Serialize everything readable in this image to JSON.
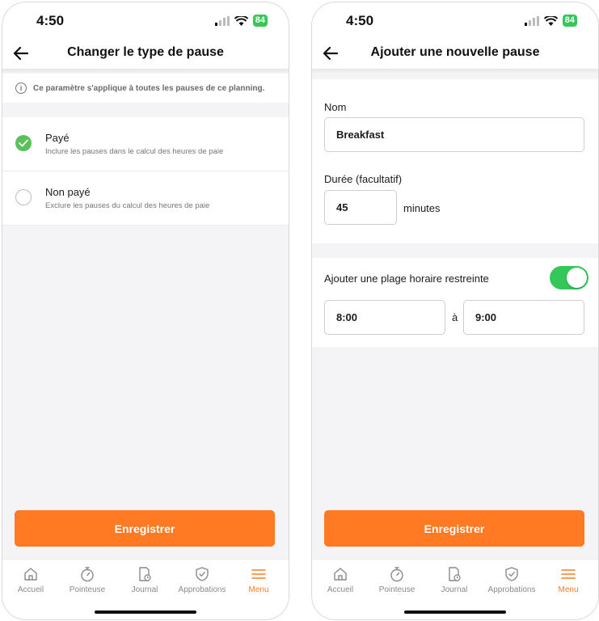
{
  "status": {
    "time": "4:50",
    "battery": "84"
  },
  "left": {
    "title": "Changer le type de pause",
    "info": "Ce paramètre s'applique à toutes les pauses de ce planning.",
    "options": [
      {
        "label": "Payé",
        "sub": "Inclure les pauses dans le calcul des heures de paie",
        "checked": true
      },
      {
        "label": "Non payé",
        "sub": "Exclure les pauses du calcul des heures de paie",
        "checked": false
      }
    ],
    "save_label": "Enregistrer"
  },
  "right": {
    "title": "Ajouter une nouvelle pause",
    "name_label": "Nom",
    "name_value": "Breakfast",
    "duration_label": "Durée (facultatif)",
    "duration_value": "45",
    "duration_unit": "minutes",
    "restrict_label": "Ajouter une plage horaire restreinte",
    "restrict_enabled": true,
    "start_time": "8:00",
    "between": "à",
    "end_time": "9:00",
    "save_label": "Enregistrer"
  },
  "tabs": [
    {
      "label": "Accueil",
      "icon": "home-icon",
      "active": false
    },
    {
      "label": "Pointeuse",
      "icon": "stopwatch-icon",
      "active": false
    },
    {
      "label": "Journal",
      "icon": "timesheet-icon",
      "active": false
    },
    {
      "label": "Approbations",
      "icon": "shield-check-icon",
      "active": false
    },
    {
      "label": "Menu",
      "icon": "menu-icon",
      "active": true
    }
  ],
  "colors": {
    "accent": "#ff7a22",
    "check": "#5ac05a",
    "toggle": "#34c759"
  }
}
